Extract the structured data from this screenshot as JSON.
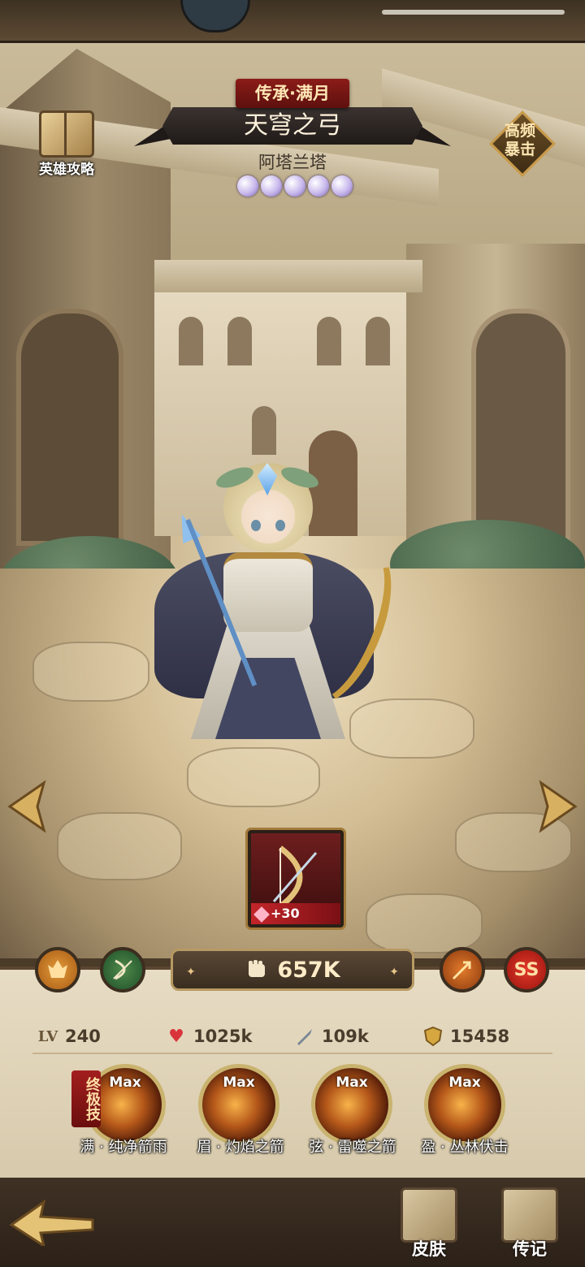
{
  "header": {
    "title_tag": "传承·满月",
    "title": "天穹之弓",
    "hero_name": "阿塔兰塔",
    "star_count": 5,
    "guide_label": "英雄攻略",
    "trait_tag": "高频\n暴击"
  },
  "weapon": {
    "level_label": "+30",
    "icon": "bow-icon"
  },
  "power": {
    "value": "657K",
    "icon": "fist-icon"
  },
  "badges": {
    "grade": "SS"
  },
  "stats": {
    "level_label": "LV",
    "level": "240",
    "hp": "1025k",
    "attack": "109k",
    "defense": "15458"
  },
  "skills": {
    "ultimate_tag": "终极技",
    "items": [
      {
        "max": "Max",
        "label": "满 · 纯净箭雨"
      },
      {
        "max": "Max",
        "label": "眉 · 灼焰之箭"
      },
      {
        "max": "Max",
        "label": "弦 · 雷噬之箭"
      },
      {
        "max": "Max",
        "label": "盈 · 丛林伏击"
      }
    ]
  },
  "bottom_nav": {
    "skin_label": "皮肤",
    "biography_label": "传记"
  },
  "colors": {
    "accent_red": "#8b1c18",
    "gold": "#c9b36e",
    "panel": "#e7dcc4"
  }
}
